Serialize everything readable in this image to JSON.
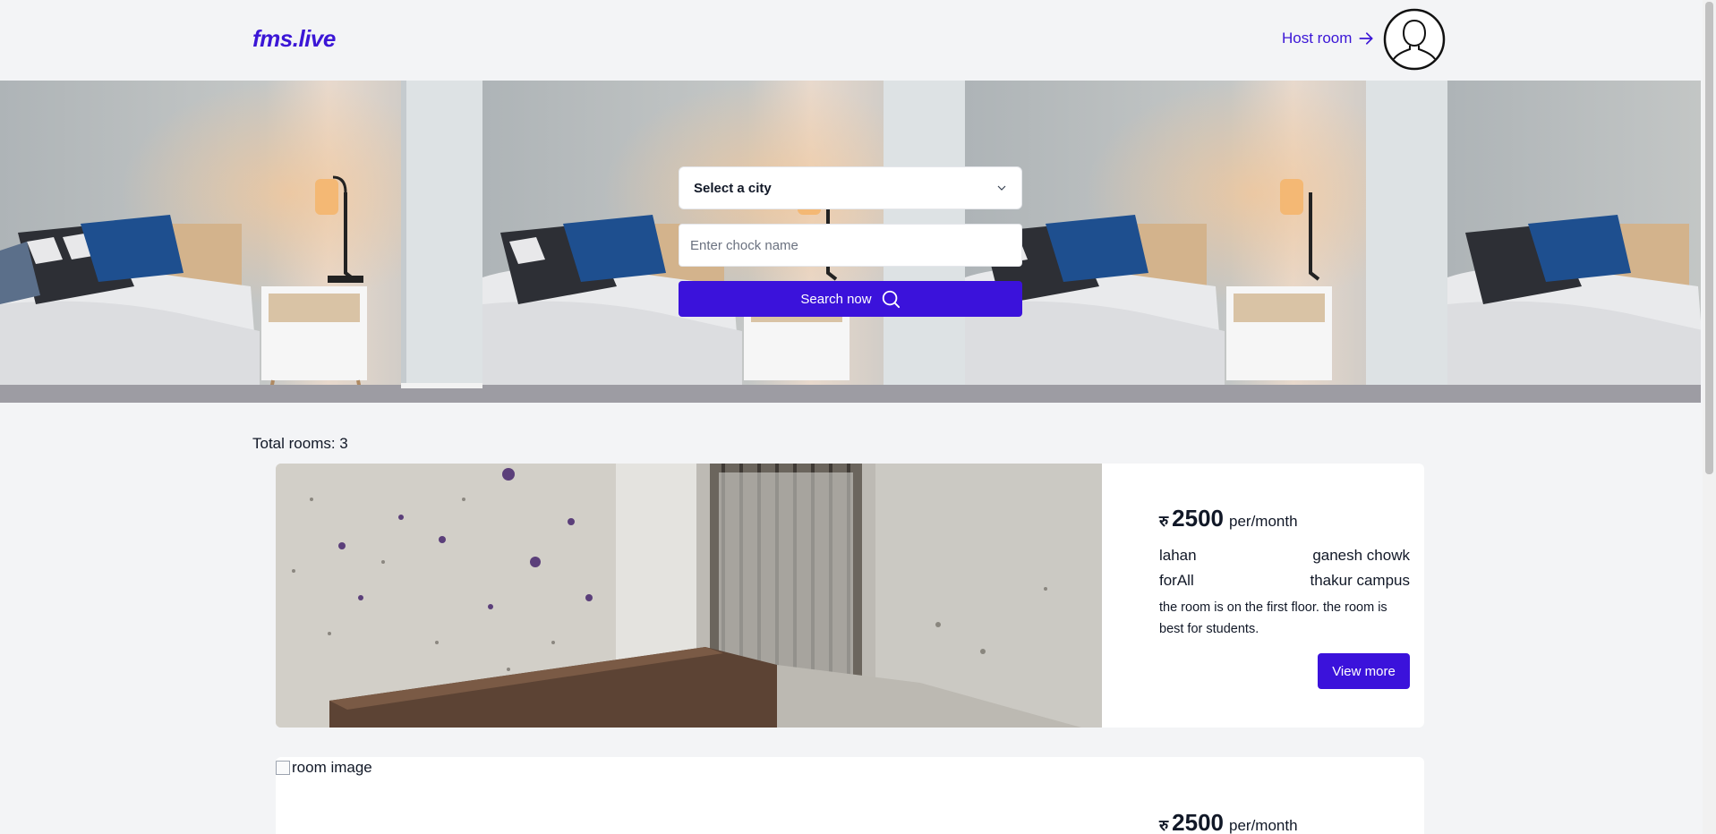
{
  "header": {
    "logo": "fms.live",
    "host_link": "Host room"
  },
  "search": {
    "city_label": "Select a city",
    "chock_placeholder": "Enter chock name",
    "button_label": "Search now"
  },
  "listing": {
    "total_label": "Total rooms: 3",
    "rooms": [
      {
        "currency": "रु",
        "price": "2500",
        "period": "per/month",
        "city": "lahan",
        "chock": "ganesh chowk",
        "for": "forAll",
        "landmark": "thakur campus",
        "description": "the room is on the first floor. the room is best for students.",
        "button_label": "View more"
      },
      {
        "image_alt": "room image",
        "currency": "रु",
        "price": "2500",
        "period": "per/month"
      }
    ]
  },
  "colors": {
    "brand": "#3b12db",
    "background": "#f3f4f6"
  }
}
